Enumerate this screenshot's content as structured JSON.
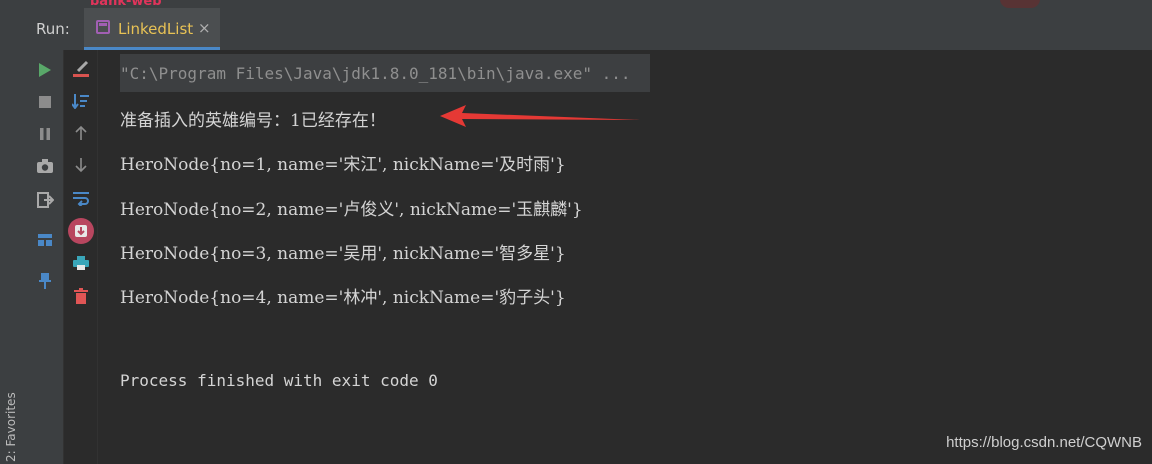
{
  "window": {
    "top_project_label": "bank-web"
  },
  "run_panel": {
    "label": "Run:",
    "tab_title": "LinkedList",
    "tab_close": "×"
  },
  "sidebar": {
    "favorites_label": "2: Favorites"
  },
  "console": {
    "command": "\"C:\\Program Files\\Java\\jdk1.8.0_181\\bin\\java.exe\" ...",
    "lines": [
      "准备插入的英雄编号：1已经存在！",
      "HeroNode{no=1, name='宋江', nickName='及时雨'}",
      "HeroNode{no=2, name='卢俊义', nickName='玉麒麟'}",
      "HeroNode{no=3, name='吴用', nickName='智多星'}",
      "HeroNode{no=4, name='林冲', nickName='豹子头'}"
    ],
    "exit_message": "Process finished with exit code 0"
  },
  "watermark": "https://blog.csdn.net/CQWNB",
  "colors": {
    "background": "#2b2b2b",
    "panel": "#3c3f41",
    "tab_title": "#e8c255",
    "run_green": "#59a869",
    "arrow_red": "#e53935"
  },
  "icons": [
    "play-icon",
    "stop-icon",
    "pause-icon",
    "camera-icon",
    "exit-icon",
    "layout-icon",
    "pin-icon",
    "clear-icon",
    "sort-icon",
    "up-icon",
    "down-icon",
    "wrap-icon",
    "scroll-end-icon",
    "print-icon",
    "trash-icon"
  ]
}
